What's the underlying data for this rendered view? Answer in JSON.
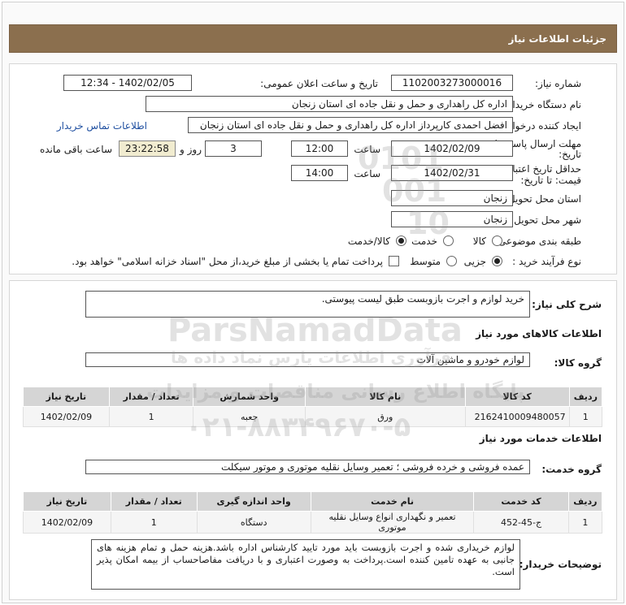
{
  "header": {
    "title": "جزئیات اطلاعات نیاز"
  },
  "fields": {
    "need_number_label": "شماره نیاز:",
    "need_number": "1102003273000016",
    "announce_label": "تاریخ و ساعت اعلان عمومی:",
    "announce_value": "1402/02/05 - 12:34",
    "buyer_org_label": "نام دستگاه خریدار:",
    "buyer_org": "اداره کل راهداری و حمل و نقل جاده ای استان زنجان",
    "requester_label": "ایجاد کننده درخواست:",
    "requester": "افضل احمدی کارپرداز اداره کل راهداری و حمل و نقل جاده ای استان زنجان",
    "contact_link": "اطلاعات تماس خریدار",
    "deadline_label_1": "مهلت ارسال پاسخ: تا",
    "deadline_label_2": "تاریخ:",
    "deadline_date": "1402/02/09",
    "time_label": "ساعت",
    "deadline_time": "12:00",
    "days_value": "3",
    "days_label": "روز و",
    "remaining_time": "23:22:58",
    "remaining_label": "ساعت باقی مانده",
    "validity_label_1": "حداقل تاریخ اعتبار",
    "validity_label_2": "قیمت: تا تاریخ:",
    "validity_date": "1402/02/31",
    "validity_time": "14:00",
    "province_label": "استان محل تحویل:",
    "province": "زنجان",
    "city_label": "شهر محل تحویل:",
    "city": "زنجان",
    "category_label": "طبقه بندی موضوعی:",
    "category_options": [
      "کالا",
      "خدمت",
      "کالا/خدمت"
    ],
    "category_selected": 2,
    "process_label": "نوع فرآیند خرید :",
    "process_options": [
      "جزیی",
      "متوسط"
    ],
    "process_selected": 0,
    "payment_note": "پرداخت تمام یا بخشی از مبلغ خرید،از محل \"اسناد خزانه اسلامی\" خواهد بود."
  },
  "summary": {
    "label": "شرح کلی نیاز:",
    "value": "خرید لوازم و اجرت بازوبست طبق لیست پیوستی."
  },
  "goods": {
    "section_title": "اطلاعات کالاهای مورد نیاز",
    "group_label": "گروه کالا:",
    "group_value": "لوازم خودرو و ماشین آلات",
    "columns": [
      "ردیف",
      "کد کالا",
      "نام کالا",
      "واحد شمارش",
      "تعداد / مقدار",
      "تاریخ نیاز"
    ],
    "rows": [
      [
        "1",
        "2162410009480057",
        "ورق",
        "جعبه",
        "1",
        "1402/02/09"
      ]
    ]
  },
  "services": {
    "section_title": "اطلاعات خدمات مورد نیاز",
    "group_label": "گروه خدمت:",
    "group_value": "عمده فروشی و خرده فروشی ؛ تعمیر وسایل نقلیه موتوری و موتور سیکلت",
    "columns": [
      "ردیف",
      "کد خدمت",
      "نام خدمت",
      "واحد اندازه گیری",
      "تعداد / مقدار",
      "تاریخ نیاز"
    ],
    "rows": [
      [
        "1",
        "ج-45-452",
        "تعمیر و نگهداری انواع وسایل نقلیه موتوری",
        "دستگاه",
        "1",
        "1402/02/09"
      ]
    ]
  },
  "buyer_notes": {
    "label": "توضیحات خریدار:",
    "value": "لوازم خریداری شده و اجرت بازوبست باید مورد تایید کارشناس اداره باشد.هزینه حمل و تمام هزینه های جانبی به عهده تامین کننده است.پرداخت به وصورت اعتباری و با دریافت مفاصاحساب از بیمه امکان پذیر است."
  },
  "watermark": {
    "brand": "ParsNamadData",
    "line1": "پایگاه اطلاع رسانی مناقصات و مزایدات",
    "line2": "فرآوری اطلاعات پارس نماد داده ها",
    "phone": "۰۲۱-۸۸۳۴۹۶۷۰-۵",
    "digits": "0101 001 10"
  }
}
